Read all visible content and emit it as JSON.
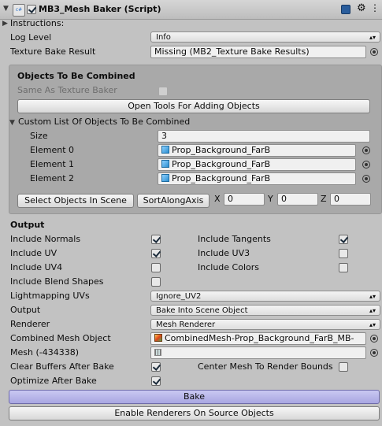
{
  "component": {
    "title": "MB3_Mesh Baker (Script)",
    "script_icon": "script-file-icon",
    "checkbox_checked": true
  },
  "instructions_label": "Instructions:",
  "log_level": {
    "label": "Log Level",
    "value": "Info"
  },
  "texture_bake_result": {
    "label": "Texture Bake Result",
    "value": "Missing (MB2_Texture Bake Results)"
  },
  "objects_box": {
    "title": "Objects To Be Combined",
    "same_as_label": "Same As Texture Baker",
    "open_tools_button": "Open Tools For Adding Objects",
    "custom_list_label": "Custom List Of Objects To Be Combined",
    "size_label": "Size",
    "size_value": "3",
    "elements": [
      {
        "label": "Element 0",
        "value": "Prop_Background_FarB"
      },
      {
        "label": "Element 1",
        "value": "Prop_Background_FarB"
      },
      {
        "label": "Element 2",
        "value": "Prop_Background_FarB"
      }
    ],
    "select_objects_button": "Select Objects In Scene",
    "sort_button": "SortAlongAxis",
    "x_label": "X",
    "x_value": "0",
    "y_label": "Y",
    "y_value": "0",
    "z_label": "Z",
    "z_value": "0"
  },
  "output": {
    "title": "Output",
    "include_normals": {
      "label": "Include Normals",
      "checked": true
    },
    "include_tangents": {
      "label": "Include Tangents",
      "checked": true
    },
    "include_uv": {
      "label": "Include UV",
      "checked": true
    },
    "include_uv3": {
      "label": "Include UV3",
      "checked": false
    },
    "include_uv4": {
      "label": "Include UV4",
      "checked": false
    },
    "include_colors": {
      "label": "Include Colors",
      "checked": false
    },
    "include_blend_shapes": {
      "label": "Include Blend Shapes",
      "checked": false
    },
    "lightmapping_uvs": {
      "label": "Lightmapping UVs",
      "value": "Ignore_UV2"
    },
    "output_mode": {
      "label": "Output",
      "value": "Bake Into Scene Object"
    },
    "renderer": {
      "label": "Renderer",
      "value": "Mesh Renderer"
    },
    "combined_mesh_object": {
      "label": "Combined Mesh Object",
      "value": "CombinedMesh-Prop_Background_FarB_MB-"
    },
    "mesh": {
      "label": "Mesh (-434338)",
      "value": ""
    },
    "clear_buffers": {
      "label": "Clear Buffers After Bake",
      "checked": true
    },
    "center_mesh": {
      "label": "Center Mesh To Render Bounds",
      "checked": false
    },
    "optimize": {
      "label": "Optimize After Bake",
      "checked": true
    }
  },
  "bake_button": "Bake",
  "enable_renderers_button": "Enable Renderers On Source Objects",
  "colors": {
    "bake_button": "#b6b4ea",
    "panel": "#c2c2c2",
    "box": "#a9a9a9"
  }
}
